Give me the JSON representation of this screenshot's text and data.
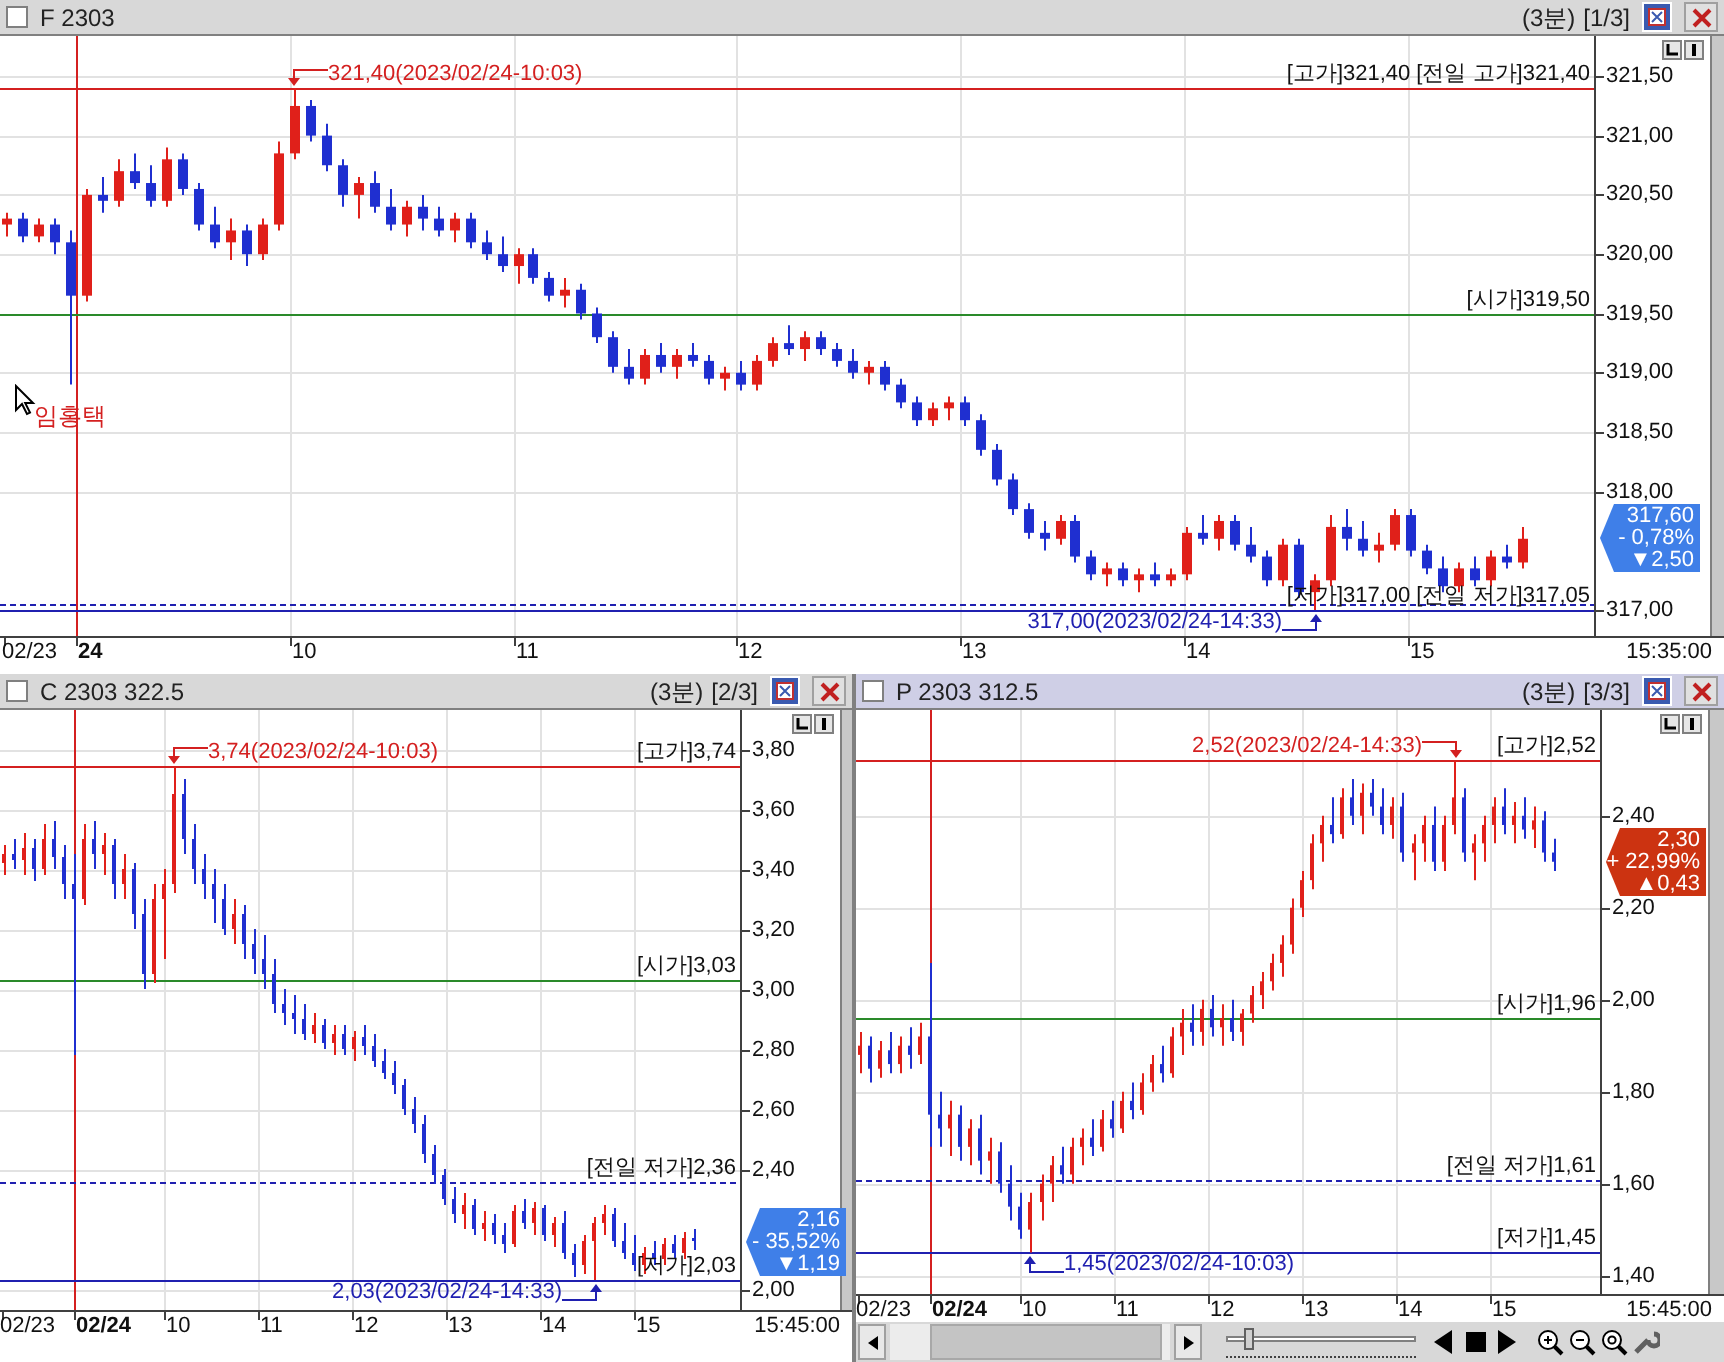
{
  "panels": [
    {
      "title": "F 2303",
      "period": "(3분)",
      "page": "[1/3]",
      "selected": false,
      "chart_data": {
        "type": "candlestick",
        "ylim": [
          316.78,
          321.84
        ],
        "grid": true,
        "ref_lines": [
          {
            "axis": "y",
            "value": 321.4,
            "label": "[고가]321,40",
            "color": "#d42020"
          },
          {
            "axis": "y",
            "value": 321.4,
            "label": "[전일 고가]321,40",
            "color": "#d42020"
          },
          {
            "axis": "y",
            "value": 319.5,
            "label": "[시가]319,50",
            "color": "#2a8a2a"
          },
          {
            "axis": "y",
            "value": 317.0,
            "label": "[저가]317,00",
            "color": "#2020b0"
          },
          {
            "axis": "y",
            "value": 317.05,
            "label": "[전일 저가]317,05",
            "color": "#2020b0"
          }
        ],
        "yticks": [
          {
            "value": 321.5,
            "label": "321,50"
          },
          {
            "value": 321,
            "label": "321,00"
          },
          {
            "value": 320.5,
            "label": "320,50"
          },
          {
            "value": 320,
            "label": "320,00"
          },
          {
            "value": 319.5,
            "label": "319,50"
          },
          {
            "value": 319,
            "label": "319,00"
          },
          {
            "value": 318.5,
            "label": "318,50"
          },
          {
            "value": 318,
            "label": "318,00"
          },
          {
            "value": 317,
            "label": "317,00"
          }
        ],
        "ohlc": [
          [
            320.25,
            320.35,
            320.15,
            320.3
          ],
          [
            320.3,
            320.35,
            320.1,
            320.15
          ],
          [
            320.15,
            320.3,
            320.1,
            320.25
          ],
          [
            320.25,
            320.3,
            320.0,
            320.1
          ],
          [
            320.1,
            320.2,
            318.9,
            319.65
          ],
          [
            319.65,
            320.55,
            319.6,
            320.5
          ],
          [
            320.5,
            320.65,
            320.35,
            320.45
          ],
          [
            320.45,
            320.8,
            320.4,
            320.7
          ],
          [
            320.7,
            320.85,
            320.55,
            320.6
          ],
          [
            320.6,
            320.75,
            320.4,
            320.45
          ],
          [
            320.45,
            320.9,
            320.4,
            320.8
          ],
          [
            320.8,
            320.85,
            320.5,
            320.55
          ],
          [
            320.55,
            320.6,
            320.2,
            320.25
          ],
          [
            320.25,
            320.4,
            320.05,
            320.1
          ],
          [
            320.1,
            320.3,
            319.95,
            320.2
          ],
          [
            320.2,
            320.25,
            319.9,
            320.0
          ],
          [
            320.0,
            320.3,
            319.95,
            320.25
          ],
          [
            320.25,
            320.95,
            320.2,
            320.85
          ],
          [
            320.85,
            321.4,
            320.8,
            321.25
          ],
          [
            321.25,
            321.3,
            320.95,
            321.0
          ],
          [
            321.0,
            321.1,
            320.7,
            320.75
          ],
          [
            320.75,
            320.8,
            320.4,
            320.5
          ],
          [
            320.5,
            320.65,
            320.3,
            320.6
          ],
          [
            320.6,
            320.7,
            320.35,
            320.4
          ],
          [
            320.4,
            320.55,
            320.2,
            320.25
          ],
          [
            320.25,
            320.45,
            320.15,
            320.4
          ],
          [
            320.4,
            320.5,
            320.2,
            320.3
          ],
          [
            320.3,
            320.4,
            320.15,
            320.2
          ],
          [
            320.2,
            320.35,
            320.1,
            320.3
          ],
          [
            320.3,
            320.35,
            320.05,
            320.1
          ],
          [
            320.1,
            320.2,
            319.95,
            320.0
          ],
          [
            320.0,
            320.15,
            319.85,
            319.9
          ],
          [
            319.9,
            320.05,
            319.75,
            320.0
          ],
          [
            320.0,
            320.05,
            319.75,
            319.8
          ],
          [
            319.8,
            319.85,
            319.6,
            319.65
          ],
          [
            319.65,
            319.8,
            319.55,
            319.7
          ],
          [
            319.7,
            319.75,
            319.45,
            319.5
          ],
          [
            319.5,
            319.55,
            319.25,
            319.3
          ],
          [
            319.3,
            319.35,
            319.0,
            319.05
          ],
          [
            319.05,
            319.2,
            318.9,
            318.95
          ],
          [
            318.95,
            319.2,
            318.9,
            319.15
          ],
          [
            319.15,
            319.25,
            319.0,
            319.05
          ],
          [
            319.05,
            319.2,
            318.95,
            319.15
          ],
          [
            319.15,
            319.25,
            319.05,
            319.1
          ],
          [
            319.1,
            319.15,
            318.9,
            318.95
          ],
          [
            318.95,
            319.05,
            318.85,
            319.0
          ],
          [
            319.0,
            319.1,
            318.85,
            318.9
          ],
          [
            318.9,
            319.15,
            318.85,
            319.1
          ],
          [
            319.1,
            319.3,
            319.05,
            319.25
          ],
          [
            319.25,
            319.4,
            319.15,
            319.2
          ],
          [
            319.2,
            319.35,
            319.1,
            319.3
          ],
          [
            319.3,
            319.35,
            319.15,
            319.2
          ],
          [
            319.2,
            319.25,
            319.05,
            319.1
          ],
          [
            319.1,
            319.2,
            318.95,
            319.0
          ],
          [
            319.0,
            319.1,
            318.9,
            319.05
          ],
          [
            319.05,
            319.1,
            318.85,
            318.9
          ],
          [
            318.9,
            318.95,
            318.7,
            318.75
          ],
          [
            318.75,
            318.8,
            318.55,
            318.6
          ],
          [
            318.6,
            318.75,
            318.55,
            318.7
          ],
          [
            318.7,
            318.8,
            318.6,
            318.75
          ],
          [
            318.75,
            318.8,
            318.55,
            318.6
          ],
          [
            318.6,
            318.65,
            318.3,
            318.35
          ],
          [
            318.35,
            318.4,
            318.05,
            318.1
          ],
          [
            318.1,
            318.15,
            317.8,
            317.85
          ],
          [
            317.85,
            317.9,
            317.6,
            317.65
          ],
          [
            317.65,
            317.75,
            317.5,
            317.6
          ],
          [
            317.6,
            317.8,
            317.55,
            317.75
          ],
          [
            317.75,
            317.8,
            317.4,
            317.45
          ],
          [
            317.45,
            317.5,
            317.25,
            317.3
          ],
          [
            317.3,
            317.4,
            317.2,
            317.35
          ],
          [
            317.35,
            317.4,
            317.2,
            317.25
          ],
          [
            317.25,
            317.35,
            317.15,
            317.3
          ],
          [
            317.3,
            317.4,
            317.2,
            317.25
          ],
          [
            317.25,
            317.35,
            317.2,
            317.3
          ],
          [
            317.3,
            317.7,
            317.25,
            317.65
          ],
          [
            317.65,
            317.8,
            317.55,
            317.6
          ],
          [
            317.6,
            317.8,
            317.5,
            317.75
          ],
          [
            317.75,
            317.8,
            317.5,
            317.55
          ],
          [
            317.55,
            317.7,
            317.4,
            317.45
          ],
          [
            317.45,
            317.5,
            317.2,
            317.25
          ],
          [
            317.25,
            317.6,
            317.2,
            317.55
          ],
          [
            317.55,
            317.6,
            317.1,
            317.15
          ],
          [
            317.15,
            317.3,
            317.0,
            317.25
          ],
          [
            317.25,
            317.8,
            317.2,
            317.7
          ],
          [
            317.7,
            317.85,
            317.5,
            317.6
          ],
          [
            317.6,
            317.75,
            317.45,
            317.5
          ],
          [
            317.5,
            317.65,
            317.4,
            317.55
          ],
          [
            317.55,
            317.85,
            317.5,
            317.8
          ],
          [
            317.8,
            317.85,
            317.45,
            317.5
          ],
          [
            317.5,
            317.55,
            317.3,
            317.35
          ],
          [
            317.35,
            317.45,
            317.15,
            317.2
          ],
          [
            317.2,
            317.4,
            317.15,
            317.35
          ],
          [
            317.35,
            317.45,
            317.2,
            317.25
          ],
          [
            317.25,
            317.5,
            317.2,
            317.45
          ],
          [
            317.45,
            317.55,
            317.35,
            317.4
          ],
          [
            317.4,
            317.7,
            317.35,
            317.6
          ],
          null,
          null,
          null,
          null
        ]
      },
      "x_labels": [
        {
          "text": "02/23",
          "bold": false
        },
        {
          "text": "24",
          "bold": true
        },
        {
          "text": "10",
          "bold": false
        },
        {
          "text": "11",
          "bold": false
        },
        {
          "text": "12",
          "bold": false
        },
        {
          "text": "13",
          "bold": false
        },
        {
          "text": "14",
          "bold": false
        },
        {
          "text": "15",
          "bold": false
        }
      ],
      "end_time": "15:35:00",
      "levels": [
        {
          "kind": "high"
        },
        {
          "kind": "prev_high"
        },
        {
          "kind": "open"
        },
        {
          "kind": "low"
        },
        {
          "kind": "prev_low"
        }
      ],
      "annotations": [
        {
          "kind": "high",
          "text": "321,40(2023/02/24-10:03)"
        },
        {
          "kind": "low",
          "text": "317,00(2023/02/24-14:33)"
        }
      ],
      "badge": {
        "price": "317,60",
        "change_pct": "- 0,78%",
        "change": "▼2,50",
        "color": "#3f7fe8"
      },
      "cursor_label": "임홍택"
    },
    {
      "title": "C 2303 322.5",
      "period": "(3분)",
      "page": "[2/3]",
      "selected": false,
      "chart_data": {
        "type": "candlestick",
        "ylim": [
          1.93,
          3.93
        ],
        "grid": true,
        "ref_lines": [
          {
            "axis": "y",
            "value": 3.74,
            "label": "[고가]3,74",
            "color": "#d42020"
          },
          {
            "axis": "y",
            "value": 3.03,
            "label": "[시가]3,03",
            "color": "#2a8a2a"
          },
          {
            "axis": "y",
            "value": 2.36,
            "label": "[전일 저가]2,36",
            "color": "#2020b0"
          },
          {
            "axis": "y",
            "value": 2.03,
            "label": "[저가]2,03",
            "color": "#2020b0"
          }
        ],
        "yticks": [
          {
            "value": 3.8,
            "label": "3,80"
          },
          {
            "value": 3.6,
            "label": "3,60"
          },
          {
            "value": 3.4,
            "label": "3,40"
          },
          {
            "value": 3.2,
            "label": "3,20"
          },
          {
            "value": 3,
            "label": "3,00"
          },
          {
            "value": 2.8,
            "label": "2,80"
          },
          {
            "value": 2.6,
            "label": "2,60"
          },
          {
            "value": 2.4,
            "label": "2,40"
          },
          {
            "value": 2,
            "label": "2,00"
          }
        ],
        "ohlc": [
          [
            3.42,
            3.48,
            3.38,
            3.45
          ],
          [
            3.45,
            3.5,
            3.4,
            3.43
          ],
          [
            3.43,
            3.52,
            3.38,
            3.47
          ],
          [
            3.47,
            3.5,
            3.36,
            3.4
          ],
          [
            3.4,
            3.55,
            3.38,
            3.5
          ],
          [
            3.5,
            3.56,
            3.4,
            3.44
          ],
          [
            3.44,
            3.48,
            3.3,
            3.35
          ],
          [
            3.35,
            3.45,
            2.78,
            3.3
          ],
          [
            3.3,
            3.55,
            3.28,
            3.5
          ],
          [
            3.5,
            3.56,
            3.4,
            3.45
          ],
          [
            3.45,
            3.52,
            3.38,
            3.48
          ],
          [
            3.48,
            3.5,
            3.3,
            3.35
          ],
          [
            3.35,
            3.45,
            3.3,
            3.4
          ],
          [
            3.4,
            3.42,
            3.2,
            3.25
          ],
          [
            3.25,
            3.3,
            3.0,
            3.05
          ],
          [
            3.05,
            3.35,
            3.02,
            3.3
          ],
          [
            3.3,
            3.4,
            3.1,
            3.35
          ],
          [
            3.35,
            3.74,
            3.32,
            3.65
          ],
          [
            3.65,
            3.7,
            3.45,
            3.5
          ],
          [
            3.5,
            3.55,
            3.35,
            3.4
          ],
          [
            3.4,
            3.45,
            3.3,
            3.35
          ],
          [
            3.35,
            3.4,
            3.22,
            3.3
          ],
          [
            3.3,
            3.35,
            3.18,
            3.2
          ],
          [
            3.2,
            3.3,
            3.15,
            3.25
          ],
          [
            3.25,
            3.28,
            3.1,
            3.15
          ],
          [
            3.15,
            3.2,
            3.05,
            3.1
          ],
          [
            3.1,
            3.18,
            3.0,
            3.05
          ],
          [
            3.05,
            3.1,
            2.92,
            2.95
          ],
          [
            2.95,
            3.0,
            2.88,
            2.92
          ],
          [
            2.92,
            2.98,
            2.85,
            2.9
          ],
          [
            2.9,
            2.95,
            2.83,
            2.85
          ],
          [
            2.85,
            2.92,
            2.82,
            2.88
          ],
          [
            2.88,
            2.9,
            2.8,
            2.82
          ],
          [
            2.82,
            2.88,
            2.78,
            2.85
          ],
          [
            2.85,
            2.88,
            2.78,
            2.8
          ],
          [
            2.8,
            2.86,
            2.76,
            2.84
          ],
          [
            2.84,
            2.88,
            2.78,
            2.81
          ],
          [
            2.81,
            2.85,
            2.74,
            2.76
          ],
          [
            2.76,
            2.8,
            2.7,
            2.72
          ],
          [
            2.72,
            2.76,
            2.65,
            2.68
          ],
          [
            2.68,
            2.7,
            2.58,
            2.6
          ],
          [
            2.6,
            2.64,
            2.52,
            2.55
          ],
          [
            2.55,
            2.58,
            2.42,
            2.45
          ],
          [
            2.45,
            2.48,
            2.35,
            2.38
          ],
          [
            2.38,
            2.4,
            2.28,
            2.3
          ],
          [
            2.3,
            2.34,
            2.22,
            2.25
          ],
          [
            2.25,
            2.32,
            2.2,
            2.28
          ],
          [
            2.28,
            2.3,
            2.18,
            2.2
          ],
          [
            2.2,
            2.26,
            2.16,
            2.22
          ],
          [
            2.22,
            2.25,
            2.15,
            2.18
          ],
          [
            2.18,
            2.22,
            2.12,
            2.15
          ],
          [
            2.15,
            2.28,
            2.14,
            2.26
          ],
          [
            2.26,
            2.3,
            2.2,
            2.22
          ],
          [
            2.22,
            2.29,
            2.18,
            2.27
          ],
          [
            2.27,
            2.28,
            2.16,
            2.18
          ],
          [
            2.18,
            2.24,
            2.14,
            2.22
          ],
          [
            2.22,
            2.26,
            2.1,
            2.12
          ],
          [
            2.12,
            2.15,
            2.04,
            2.08
          ],
          [
            2.08,
            2.18,
            2.05,
            2.16
          ],
          [
            2.16,
            2.24,
            2.03,
            2.22
          ],
          [
            2.22,
            2.28,
            2.18,
            2.25
          ],
          [
            2.25,
            2.27,
            2.14,
            2.16
          ],
          [
            2.16,
            2.22,
            2.1,
            2.12
          ],
          [
            2.12,
            2.18,
            2.06,
            2.08
          ],
          [
            2.08,
            2.14,
            2.05,
            2.12
          ],
          [
            2.12,
            2.16,
            2.08,
            2.1
          ],
          [
            2.1,
            2.17,
            2.08,
            2.15
          ],
          [
            2.15,
            2.18,
            2.1,
            2.12
          ],
          [
            2.12,
            2.19,
            2.1,
            2.17
          ],
          [
            2.17,
            2.2,
            2.13,
            2.16
          ],
          null,
          null,
          null,
          null
        ]
      },
      "x_labels": [
        {
          "text": "02/23",
          "bold": false
        },
        {
          "text": "02/24",
          "bold": true
        },
        {
          "text": "10",
          "bold": false
        },
        {
          "text": "11",
          "bold": false
        },
        {
          "text": "12",
          "bold": false
        },
        {
          "text": "13",
          "bold": false
        },
        {
          "text": "14",
          "bold": false
        },
        {
          "text": "15",
          "bold": false
        }
      ],
      "end_time": "15:45:00",
      "levels": [
        {
          "kind": "high"
        },
        {
          "kind": "open"
        },
        {
          "kind": "prev_low"
        },
        {
          "kind": "low"
        }
      ],
      "annotations": [
        {
          "kind": "high",
          "text": "3,74(2023/02/24-10:03)"
        },
        {
          "kind": "low",
          "text": "2,03(2023/02/24-14:33)"
        }
      ],
      "badge": {
        "price": "2,16",
        "change_pct": "- 35,52%",
        "change": "▼1,19",
        "color": "#3f7fe8"
      }
    },
    {
      "title": "P 2303 312.5",
      "period": "(3분)",
      "page": "[3/3]",
      "selected": true,
      "chart_data": {
        "type": "candlestick",
        "ylim": [
          1.36,
          2.63
        ],
        "grid": true,
        "ref_lines": [
          {
            "axis": "y",
            "value": 2.52,
            "label": "[고가]2,52",
            "color": "#d42020"
          },
          {
            "axis": "y",
            "value": 1.96,
            "label": "[시가]1,96",
            "color": "#2a8a2a"
          },
          {
            "axis": "y",
            "value": 1.61,
            "label": "[전일 저가]1,61",
            "color": "#2020b0"
          },
          {
            "axis": "y",
            "value": 1.45,
            "label": "[저가]1,45",
            "color": "#2020b0"
          }
        ],
        "yticks": [
          {
            "value": 2.4,
            "label": "2,40"
          },
          {
            "value": 2.2,
            "label": "2,20"
          },
          {
            "value": 2,
            "label": "2,00"
          },
          {
            "value": 1.8,
            "label": "1,80"
          },
          {
            "value": 1.6,
            "label": "1,60"
          },
          {
            "value": 1.4,
            "label": "1,40"
          }
        ],
        "ohlc": [
          [
            1.88,
            1.93,
            1.84,
            1.9
          ],
          [
            1.9,
            1.92,
            1.82,
            1.85
          ],
          [
            1.85,
            1.91,
            1.83,
            1.89
          ],
          [
            1.89,
            1.93,
            1.84,
            1.86
          ],
          [
            1.86,
            1.92,
            1.84,
            1.9
          ],
          [
            1.9,
            1.94,
            1.85,
            1.88
          ],
          [
            1.88,
            1.95,
            1.86,
            1.92
          ],
          [
            1.92,
            2.08,
            1.68,
            1.75
          ],
          [
            1.75,
            1.8,
            1.68,
            1.72
          ],
          [
            1.72,
            1.78,
            1.66,
            1.75
          ],
          [
            1.75,
            1.77,
            1.65,
            1.68
          ],
          [
            1.68,
            1.74,
            1.64,
            1.72
          ],
          [
            1.72,
            1.75,
            1.62,
            1.65
          ],
          [
            1.65,
            1.7,
            1.6,
            1.67
          ],
          [
            1.67,
            1.69,
            1.58,
            1.6
          ],
          [
            1.6,
            1.64,
            1.52,
            1.55
          ],
          [
            1.55,
            1.58,
            1.48,
            1.5
          ],
          [
            1.5,
            1.58,
            1.45,
            1.56
          ],
          [
            1.56,
            1.62,
            1.52,
            1.6
          ],
          [
            1.6,
            1.66,
            1.56,
            1.64
          ],
          [
            1.64,
            1.68,
            1.6,
            1.62
          ],
          [
            1.62,
            1.7,
            1.6,
            1.68
          ],
          [
            1.68,
            1.72,
            1.64,
            1.7
          ],
          [
            1.7,
            1.74,
            1.66,
            1.68
          ],
          [
            1.68,
            1.76,
            1.67,
            1.74
          ],
          [
            1.74,
            1.78,
            1.7,
            1.72
          ],
          [
            1.72,
            1.8,
            1.71,
            1.78
          ],
          [
            1.78,
            1.82,
            1.74,
            1.76
          ],
          [
            1.76,
            1.84,
            1.75,
            1.82
          ],
          [
            1.82,
            1.88,
            1.8,
            1.86
          ],
          [
            1.86,
            1.9,
            1.82,
            1.84
          ],
          [
            1.84,
            1.94,
            1.83,
            1.92
          ],
          [
            1.92,
            1.98,
            1.88,
            1.95
          ],
          [
            1.95,
            1.99,
            1.9,
            1.93
          ],
          [
            1.93,
            2.0,
            1.9,
            1.98
          ],
          [
            1.98,
            2.01,
            1.92,
            1.94
          ],
          [
            1.94,
            1.99,
            1.9,
            1.96
          ],
          [
            1.96,
            2.0,
            1.91,
            1.93
          ],
          [
            1.93,
            1.98,
            1.9,
            1.97
          ],
          [
            1.97,
            2.03,
            1.95,
            2.01
          ],
          [
            2.01,
            2.06,
            1.98,
            2.04
          ],
          [
            2.04,
            2.1,
            2.02,
            2.08
          ],
          [
            2.08,
            2.14,
            2.05,
            2.12
          ],
          [
            2.12,
            2.22,
            2.1,
            2.2
          ],
          [
            2.2,
            2.28,
            2.18,
            2.26
          ],
          [
            2.26,
            2.36,
            2.24,
            2.34
          ],
          [
            2.34,
            2.4,
            2.3,
            2.38
          ],
          [
            2.38,
            2.44,
            2.34,
            2.36
          ],
          [
            2.36,
            2.46,
            2.35,
            2.44
          ],
          [
            2.44,
            2.48,
            2.38,
            2.4
          ],
          [
            2.4,
            2.47,
            2.36,
            2.45
          ],
          [
            2.45,
            2.48,
            2.4,
            2.42
          ],
          [
            2.42,
            2.46,
            2.36,
            2.38
          ],
          [
            2.38,
            2.44,
            2.35,
            2.42
          ],
          [
            2.42,
            2.45,
            2.3,
            2.32
          ],
          [
            2.32,
            2.36,
            2.26,
            2.34
          ],
          [
            2.34,
            2.4,
            2.3,
            2.38
          ],
          [
            2.38,
            2.42,
            2.28,
            2.3
          ],
          [
            2.3,
            2.4,
            2.28,
            2.38
          ],
          [
            2.38,
            2.52,
            2.36,
            2.44
          ],
          [
            2.44,
            2.46,
            2.3,
            2.32
          ],
          [
            2.32,
            2.36,
            2.26,
            2.34
          ],
          [
            2.34,
            2.4,
            2.3,
            2.38
          ],
          [
            2.38,
            2.44,
            2.34,
            2.42
          ],
          [
            2.42,
            2.46,
            2.36,
            2.38
          ],
          [
            2.38,
            2.43,
            2.34,
            2.4
          ],
          [
            2.4,
            2.44,
            2.35,
            2.37
          ],
          [
            2.37,
            2.42,
            2.33,
            2.39
          ],
          [
            2.39,
            2.41,
            2.3,
            2.32
          ],
          [
            2.32,
            2.35,
            2.28,
            2.3
          ],
          null,
          null,
          null,
          null
        ]
      },
      "x_labels": [
        {
          "text": "02/23",
          "bold": false
        },
        {
          "text": "02/24",
          "bold": true
        },
        {
          "text": "10",
          "bold": false
        },
        {
          "text": "11",
          "bold": false
        },
        {
          "text": "12",
          "bold": false
        },
        {
          "text": "13",
          "bold": false
        },
        {
          "text": "14",
          "bold": false
        },
        {
          "text": "15",
          "bold": false
        }
      ],
      "end_time": "15:45:00",
      "levels": [
        {
          "kind": "high"
        },
        {
          "kind": "open"
        },
        {
          "kind": "prev_low"
        },
        {
          "kind": "low"
        }
      ],
      "annotations": [
        {
          "kind": "high",
          "text": "2,52(2023/02/24-14:33)"
        },
        {
          "kind": "low",
          "text": "1,45(2023/02/24-10:03)"
        }
      ],
      "badge": {
        "price": "2,30",
        "change_pct": "+ 22,99%",
        "change": "▲0,43",
        "color": "#cc3311"
      },
      "controls": {
        "slider": {
          "level": 0.1
        }
      }
    }
  ]
}
